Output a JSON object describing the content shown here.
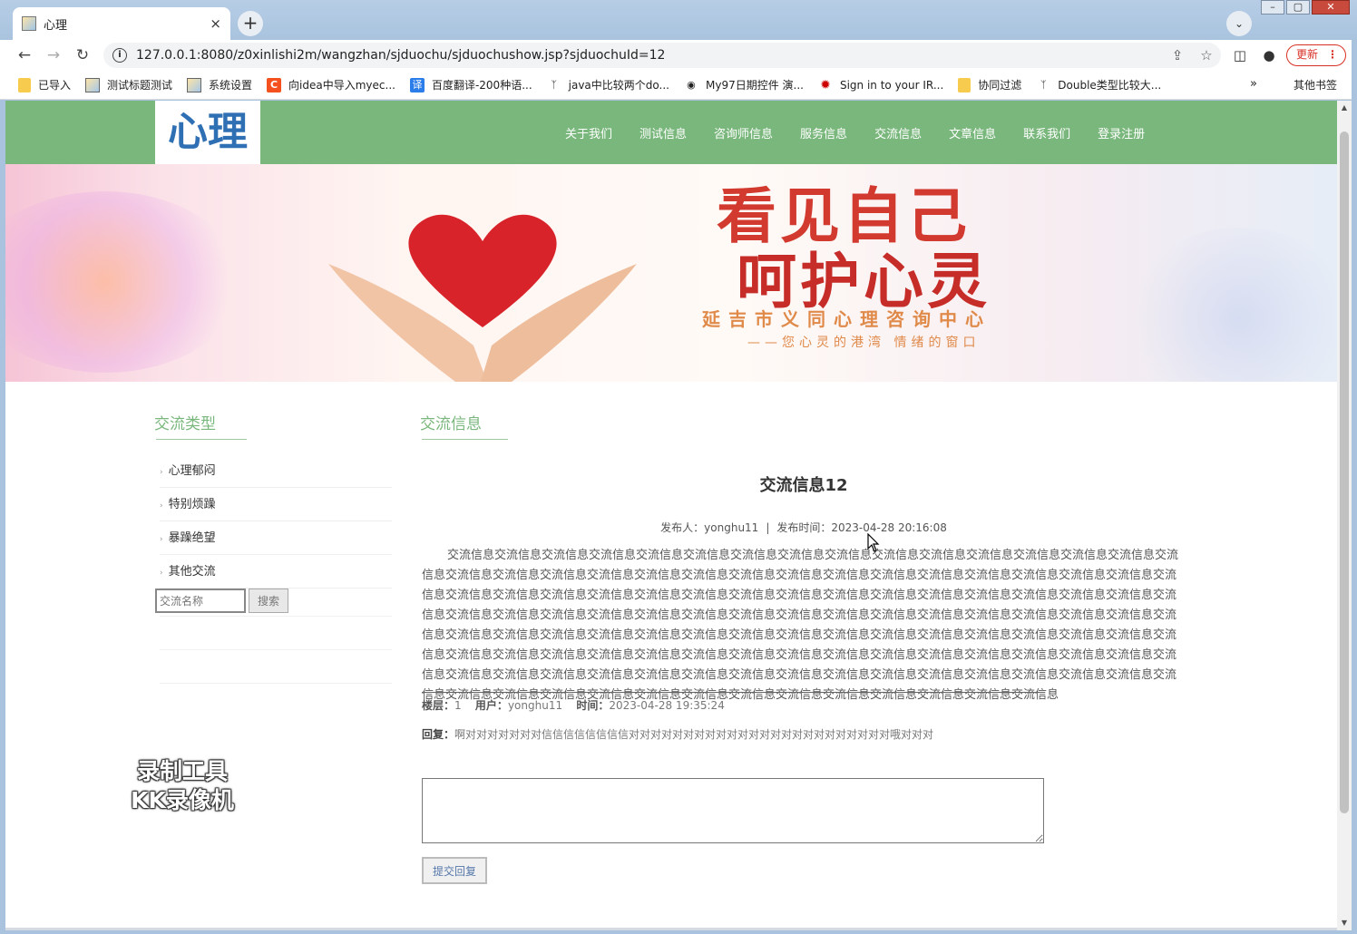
{
  "browser": {
    "tab_title": "心理",
    "tab_close": "×",
    "new_tab": "+",
    "tab_search": "⌄",
    "window_controls": [
      "–",
      "▢",
      "✕"
    ],
    "url": "127.0.0.1:8080/z0xinlishi2m/wangzhan/sjduochu/sjduochushow.jsp?sjduochuId=12",
    "update_label": "更新",
    "bookmarks": [
      {
        "label": "已导入",
        "icon": "folder"
      },
      {
        "label": "测试标题测试",
        "icon": "image"
      },
      {
        "label": "系统设置",
        "icon": "image"
      },
      {
        "label": "向idea中导入myec...",
        "icon": "c-logo"
      },
      {
        "label": "百度翻译-200种语...",
        "icon": "translate"
      },
      {
        "label": "java中比较两个do...",
        "icon": "bird"
      },
      {
        "label": "My97日期控件 演...",
        "icon": "globe"
      },
      {
        "label": "Sign in to your IR...",
        "icon": "maple-leaf"
      },
      {
        "label": "协同过滤",
        "icon": "folder"
      },
      {
        "label": "Double类型比较大...",
        "icon": "bird"
      }
    ],
    "bookmarks_more": "»",
    "other_bookmarks": "其他书签"
  },
  "site": {
    "logo": "心理",
    "nav": [
      "关于我们",
      "测试信息",
      "咨询师信息",
      "服务信息",
      "交流信息",
      "文章信息",
      "联系我们",
      "登录注册"
    ],
    "banner": {
      "line1": "看见自己",
      "line2": "呵护心灵",
      "line3": "延吉市义同心理咨询中心",
      "line4": "——您心灵的港湾 情绪的窗口"
    }
  },
  "sidebar": {
    "title": "交流类型",
    "categories": [
      "心理郁闷",
      "特别烦躁",
      "暴躁绝望",
      "其他交流"
    ],
    "search_placeholder": "交流名称",
    "search_button": "搜索"
  },
  "main": {
    "section_title": "交流信息",
    "article_title": "交流信息12",
    "publisher_label": "发布人：",
    "publisher": "yonghu11",
    "time_label": "发布时间：",
    "publish_time": "2023-04-28 20:16:08",
    "meta_sep": "|",
    "content": "交流信息交流信息交流信息交流信息交流信息交流信息交流信息交流信息交流信息交流信息交流信息交流信息交流信息交流信息交流信息交流信息交流信息交流信息交流信息交流信息交流信息交流信息交流信息交流信息交流信息交流信息交流信息交流信息交流信息交流信息交流信息交流信息交流信息交流信息交流信息交流信息交流信息交流信息交流信息交流信息交流信息交流信息交流信息交流信息交流信息交流信息交流信息交流信息交流信息交流信息交流信息交流信息交流信息交流信息交流信息交流信息交流信息交流信息交流信息交流信息交流信息交流信息交流信息交流信息交流信息交流信息交流信息交流信息交流信息交流信息交流信息交流信息交流信息交流信息交流信息交流信息交流信息交流信息交流信息交流信息交流信息交流信息交流信息交流信息交流信息交流信息交流信息交流信息交流信息交流信息交流信息交流信息交流信息交流信息交流信息交流信息交流信息交流信息交流信息交流信息交流信息交流信息交流信息交流信息交流信息交流信息交流信息交流信息交流信息交流信息交流信息交流信息交流信息交流信息交流信息交流信息交流信息交流信息交流信息交流信息交流信息交流信息交流信息交流信息交流信息",
    "reply_floor_label": "楼层：",
    "reply_floor": "1",
    "reply_user_label": "用户：",
    "reply_user": "yonghu11",
    "reply_time_label": "时间：",
    "reply_time": "2023-04-28 19:35:24",
    "reply_label": "回复：",
    "reply_text": "啊对对对对对对对信信信信信信信信对对对对对对对对对对对对对对对对对对对对对对对对哦对对对",
    "submit_button": "提交回复"
  },
  "watermark": {
    "line1": "录制工具",
    "line2": "KK录像机"
  }
}
